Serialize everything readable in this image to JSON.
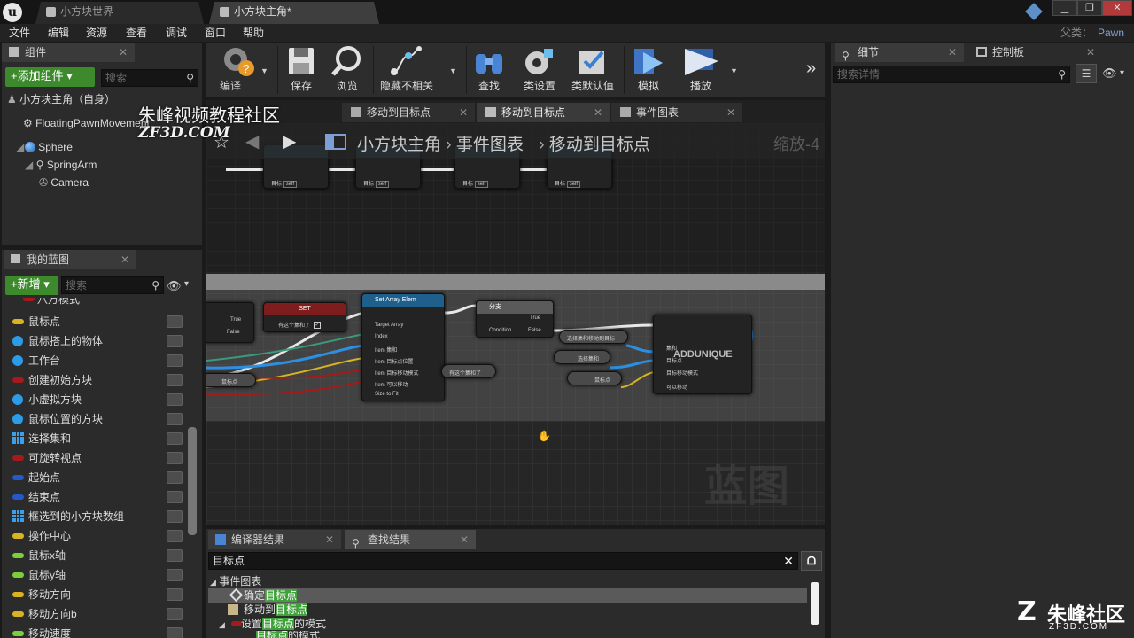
{
  "window": {
    "tabs": [
      "小方块世界",
      "小方块主角*"
    ],
    "parent_label": "父类：",
    "parent_value": "Pawn"
  },
  "menu": [
    "文件",
    "编辑",
    "资源",
    "查看",
    "调试",
    "窗口",
    "帮助"
  ],
  "components_panel": {
    "tab": "组件",
    "add_button": "+添加组件",
    "search_placeholder": "搜索",
    "root": "小方块主角（自身）",
    "items": [
      "FloatingPawnMovement",
      "Sphere",
      "SpringArm",
      "Camera"
    ]
  },
  "my_blueprint": {
    "tab": "我的蓝图",
    "new_button": "+新增",
    "search_placeholder": "搜索",
    "partial_top": "八万模式",
    "variables": [
      {
        "label": "鼠标点",
        "icon": "yellow-pill-icon",
        "color": "#d9b421"
      },
      {
        "label": "鼠标搭上的物体",
        "icon": "blue-dot-icon",
        "color": "#2c9be8"
      },
      {
        "label": "工作台",
        "icon": "blue-dot-icon",
        "color": "#2c9be8"
      },
      {
        "label": "创建初始方块",
        "icon": "red-pill-icon",
        "color": "#a51a1a"
      },
      {
        "label": "小虚拟方块",
        "icon": "blue-dot-icon",
        "color": "#2c9be8"
      },
      {
        "label": "鼠标位置的方块",
        "icon": "blue-dot-icon",
        "color": "#2c9be8"
      },
      {
        "label": "选择集和",
        "icon": "blue-grid-icon",
        "color": "#3aa0e8"
      },
      {
        "label": "可旋转视点",
        "icon": "red-pill-icon",
        "color": "#a51a1a"
      },
      {
        "label": "起始点",
        "icon": "blue-pill-icon",
        "color": "#2559c9"
      },
      {
        "label": "结束点",
        "icon": "blue-pill-icon",
        "color": "#2559c9"
      },
      {
        "label": "框选到的小方块数组",
        "icon": "blue-grid-icon",
        "color": "#3aa0e8"
      },
      {
        "label": "操作中心",
        "icon": "yellow-pill-icon",
        "color": "#d9b421"
      },
      {
        "label": "鼠标x轴",
        "icon": "green-pill-icon",
        "color": "#7bcf3c"
      },
      {
        "label": "鼠标y轴",
        "icon": "green-pill-icon",
        "color": "#7bcf3c"
      },
      {
        "label": "移动方向",
        "icon": "yellow-pill-icon",
        "color": "#d9b421"
      },
      {
        "label": "移动方向b",
        "icon": "yellow-pill-icon",
        "color": "#d9b421"
      },
      {
        "label": "移动速度",
        "icon": "green-pill-icon",
        "color": "#7bcf3c"
      }
    ]
  },
  "toolbar": [
    "编译",
    "保存",
    "浏览",
    "隐藏不相关",
    "查找",
    "类设置",
    "类默认值",
    "模拟",
    "播放"
  ],
  "graph_tabs": [
    "移动到目标点",
    "移动到目标点",
    "事件图表"
  ],
  "overlay_title": "朱峰视频教程社区",
  "overlay_logo": "ZF3D.COM",
  "breadcrumb": [
    "小方块主角",
    "事件图表",
    "移动到目标点"
  ],
  "zoom": "缩放-4",
  "graph_watermark": "蓝图",
  "nodes": {
    "set_label": "SET",
    "set_pin": "有这个集和了",
    "set_array_title": "Set Array Elem",
    "set_array_pins": [
      "Target Array",
      "Index",
      "Item 集和",
      "Item 目标点位置",
      "Item 目标移动模式",
      "Item 可以移动",
      "Size to Fit"
    ],
    "branch_title": "分支",
    "branch_pins": [
      "Condition",
      "True",
      "False"
    ],
    "top_pin": "目标",
    "top_self": "self",
    "true_label": "True",
    "false_label": "False",
    "mouse_pt_var": "鼠标点",
    "has_set_var": "有这个集和了",
    "select_set_var": "选择集和",
    "select_move_target": "选择集和移动到目标",
    "add_unique": "ADDUNIQUE",
    "make_pins": [
      "集和",
      "目标点",
      "目标移动模式",
      "可以移动"
    ]
  },
  "right_panels": {
    "details_tab": "细节",
    "control_tab": "控制板",
    "search_placeholder": "搜索详情"
  },
  "bottom": {
    "compiler_tab": "编译器结果",
    "find_tab": "查找结果",
    "search_value": "目标点",
    "results": [
      {
        "pre": "事件图表",
        "hl": "",
        "post": ""
      },
      {
        "pre": "确定",
        "hl": "目标点",
        "post": ""
      },
      {
        "pre": "移动到",
        "hl": "目标点",
        "post": ""
      },
      {
        "pre": "设置",
        "hl": "目标点",
        "post": "的模式"
      },
      {
        "pre": "",
        "hl": "目标点",
        "post": "的模式"
      }
    ]
  },
  "corner_brand": "朱峰社区",
  "corner_site": "ZF3D.COM"
}
